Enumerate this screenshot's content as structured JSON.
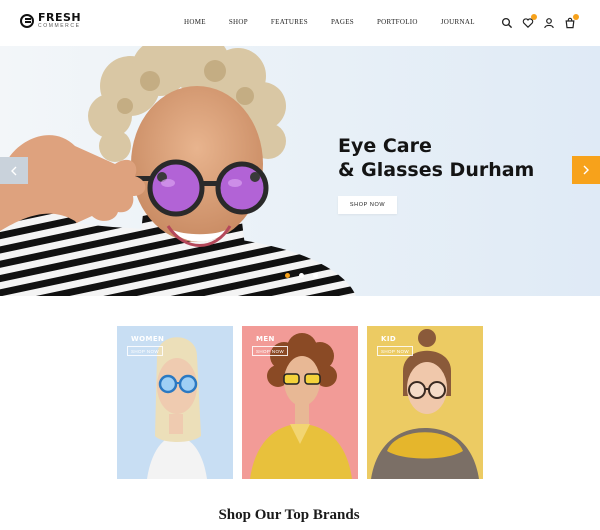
{
  "brand": {
    "name": "FRESH",
    "tagline": "COMMERCE"
  },
  "nav": [
    "HOME",
    "SHOP",
    "FEATURES",
    "PAGES",
    "PORTFOLIO",
    "JOURNAL"
  ],
  "header_icons": [
    "search-icon",
    "heart-icon",
    "user-icon",
    "cart-icon"
  ],
  "hero": {
    "title_line1": "Eye Care",
    "title_line2": "& Glasses Durham",
    "button": "SHOP NOW",
    "slides": 3,
    "active_slide": 1
  },
  "categories": [
    {
      "label": "WOMEN",
      "button": "SHOP NOW",
      "bg": "#c8def3"
    },
    {
      "label": "MEN",
      "button": "SHOP NOW",
      "bg": "#f29b97"
    },
    {
      "label": "KID",
      "button": "SHOP NOW",
      "bg": "#eccb63"
    }
  ],
  "section_title": "Shop Our Top Brands",
  "colors": {
    "accent": "#f7a21b",
    "text": "#141414"
  }
}
